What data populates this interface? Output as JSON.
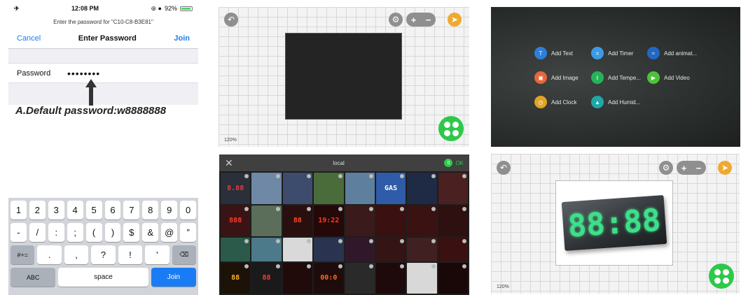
{
  "phone": {
    "status": {
      "time": "12:08 PM",
      "battery": "92%",
      "battery_level": 0.92
    },
    "prompt": "Enter the password for \"C10-C8-B3E81\"",
    "nav": {
      "cancel": "Cancel",
      "title": "Enter Password",
      "join": "Join"
    },
    "password": {
      "label": "Password",
      "value": "••••••••"
    },
    "note": "A.Default password:w8888888",
    "keyboard": {
      "row1": [
        "1",
        "2",
        "3",
        "4",
        "5",
        "6",
        "7",
        "8",
        "9",
        "0"
      ],
      "row2": [
        "-",
        "/",
        ":",
        ";",
        "(",
        ")",
        "$",
        "&",
        "@",
        "”"
      ],
      "row3": [
        "#+=",
        ".",
        ",",
        "?",
        "!",
        "'",
        "⌫"
      ],
      "row4": {
        "abc": "ABC",
        "space": "space",
        "join": "Join"
      }
    }
  },
  "editor_top": {
    "zoom": "120%",
    "plus": "+",
    "minus": "−"
  },
  "editor_bottom": {
    "zoom": "120%",
    "plus": "+",
    "minus": "−",
    "sign_digits": "88:88"
  },
  "gallery": {
    "title": "local",
    "count": "0",
    "ok": "OK",
    "thumbs": [
      {
        "bg": "#2a2f3a",
        "fg": "#e83b3b",
        "t": "8.88"
      },
      {
        "bg": "#6e88a6",
        "fg": "#fff",
        "t": ""
      },
      {
        "bg": "#3d4b6c",
        "fg": "#fff",
        "t": ""
      },
      {
        "bg": "#4a6c3a",
        "fg": "#fff",
        "t": ""
      },
      {
        "bg": "#5f7f9e",
        "fg": "#fff",
        "t": ""
      },
      {
        "bg": "#2f5ba8",
        "fg": "#fff",
        "t": "GAS"
      },
      {
        "bg": "#1f2a45",
        "fg": "#e8443b",
        "t": ""
      },
      {
        "bg": "#4a2020",
        "fg": "#ff3a2a",
        "t": ""
      },
      {
        "bg": "#3a1414",
        "fg": "#ff3a2a",
        "t": "888"
      },
      {
        "bg": "#5a6e5a",
        "fg": "#fff",
        "t": ""
      },
      {
        "bg": "#2a0f0f",
        "fg": "#ff4a2a",
        "t": "88"
      },
      {
        "bg": "#250808",
        "fg": "#ff3a1e",
        "t": "19:22"
      },
      {
        "bg": "#3a1a1a",
        "fg": "#ff3a2a",
        "t": ""
      },
      {
        "bg": "#3b1010",
        "fg": "#ff5a3a",
        "t": ""
      },
      {
        "bg": "#3a1212",
        "fg": "#ff4a3a",
        "t": ""
      },
      {
        "bg": "#2e1010",
        "fg": "#ff3a2a",
        "t": ""
      },
      {
        "bg": "#2c5a4a",
        "fg": "#fff",
        "t": ""
      },
      {
        "bg": "#4c7a8a",
        "fg": "#fff",
        "t": ""
      },
      {
        "bg": "#d9d9d9",
        "fg": "#b22",
        "t": ""
      },
      {
        "bg": "#2a3450",
        "fg": "#ff5a3a",
        "t": ""
      },
      {
        "bg": "#30182a",
        "fg": "#ff3a2a",
        "t": ""
      },
      {
        "bg": "#341414",
        "fg": "#ff4a3a",
        "t": ""
      },
      {
        "bg": "#402020",
        "fg": "#ff3a2a",
        "t": ""
      },
      {
        "bg": "#3a1010",
        "fg": "#ff3a2a",
        "t": ""
      },
      {
        "bg": "#1c1208",
        "fg": "#ffb020",
        "t": "88"
      },
      {
        "bg": "#1a1a1a",
        "fg": "#ff3a2a",
        "t": "88"
      },
      {
        "bg": "#200a0a",
        "fg": "#ff3a1e",
        "t": ""
      },
      {
        "bg": "#1e0c0c",
        "fg": "#ff6a1e",
        "t": "00:0"
      },
      {
        "bg": "#2a2a2a",
        "fg": "#ddd",
        "t": ""
      },
      {
        "bg": "#1e0a0a",
        "fg": "#ff3a2a",
        "t": ""
      },
      {
        "bg": "#d8d8d8",
        "fg": "#c22",
        "t": ""
      },
      {
        "bg": "#1a0808",
        "fg": "#ff3a2a",
        "t": ""
      }
    ]
  },
  "add_menu": {
    "items": [
      {
        "label": "Add Text",
        "color": "#2d7fd9",
        "glyph": "T"
      },
      {
        "label": "Add Timer",
        "color": "#3c9be8",
        "glyph": "="
      },
      {
        "label": "Add animat...",
        "color": "#2168c4",
        "glyph": "≈"
      },
      {
        "label": "Add Image",
        "color": "#e8663a",
        "glyph": "▣"
      },
      {
        "label": "Add Tempe...",
        "color": "#27b25a",
        "glyph": "ℓ"
      },
      {
        "label": "Add Video",
        "color": "#4cc33a",
        "glyph": "▶"
      },
      {
        "label": "Add Clock",
        "color": "#e0a325",
        "glyph": "◷"
      },
      {
        "label": "Add Humid...",
        "color": "#1fa8a8",
        "glyph": "▲"
      }
    ]
  }
}
